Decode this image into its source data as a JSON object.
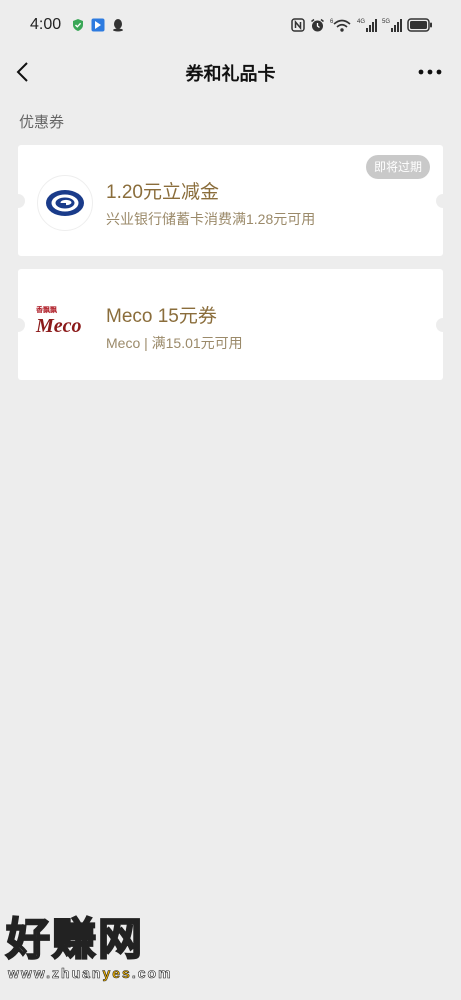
{
  "status_bar": {
    "time": "4:00",
    "signal_labels": [
      "6",
      "4G",
      "5G"
    ]
  },
  "nav": {
    "title": "券和礼品卡"
  },
  "section": {
    "label": "优惠券"
  },
  "coupons": [
    {
      "title": "1.20元立减金",
      "description": "兴业银行储蓄卡消费满1.28元可用",
      "badge": "即将过期",
      "logo_icon": "cib-bank-logo-icon"
    },
    {
      "title": "Meco 15元券",
      "description": "Meco | 满15.01元可用",
      "logo_small_text": "香飘飘",
      "logo_text": "Meco",
      "logo_icon": "meco-logo-icon"
    }
  ],
  "watermark": {
    "main": "好赚网",
    "url_prefix": "www.zhuan",
    "url_accent": "yes",
    "url_suffix": ".com"
  },
  "colors": {
    "background": "#ededed",
    "coupon_title": "#8a6d3b",
    "coupon_desc": "#9b8a6a",
    "badge_bg": "#c9c9c9",
    "bank_logo_blue": "#1a3b8a",
    "meco_red": "#8b1a1a"
  }
}
